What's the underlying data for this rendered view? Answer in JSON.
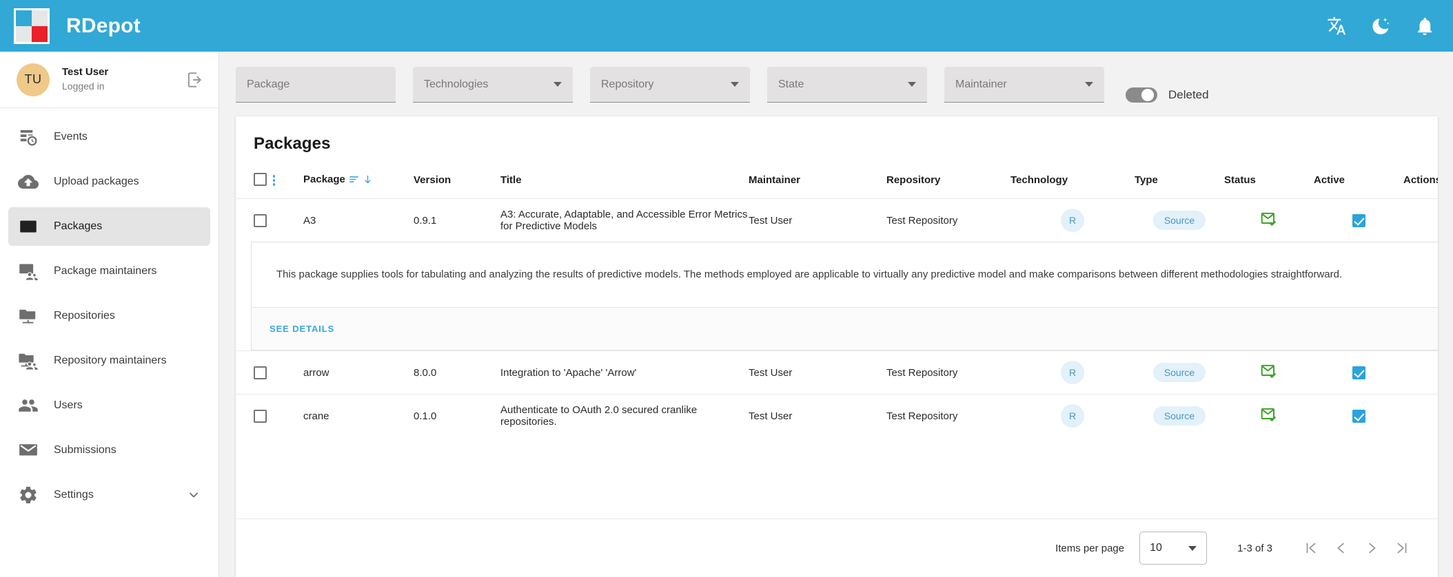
{
  "app": {
    "brand": "RDepot",
    "logo_colors": {
      "blue": "#31a8d5",
      "gray": "#e6e7e8",
      "red": "#e8212a"
    },
    "accent": "#31a8d5"
  },
  "topbar": {
    "icons": [
      {
        "name": "language-icon",
        "label": "Language"
      },
      {
        "name": "dark-mode-icon",
        "label": "Dark mode"
      },
      {
        "name": "notifications-icon",
        "label": "Notifications"
      }
    ]
  },
  "sidebar": {
    "user": {
      "initials": "TU",
      "name": "Test User",
      "status": "Logged in",
      "logout_icon": "logout-icon"
    },
    "items": [
      {
        "label": "Events",
        "icon": "events-icon",
        "active": false,
        "expandable": false
      },
      {
        "label": "Upload packages",
        "icon": "upload-cloud-icon",
        "active": false,
        "expandable": false
      },
      {
        "label": "Packages",
        "icon": "package-icon",
        "active": true,
        "expandable": false
      },
      {
        "label": "Package maintainers",
        "icon": "package-maintainers-icon",
        "active": false,
        "expandable": false
      },
      {
        "label": "Repositories",
        "icon": "repository-icon",
        "active": false,
        "expandable": false
      },
      {
        "label": "Repository maintainers",
        "icon": "repository-maintainers-icon",
        "active": false,
        "expandable": false
      },
      {
        "label": "Users",
        "icon": "users-icon",
        "active": false,
        "expandable": false
      },
      {
        "label": "Submissions",
        "icon": "submissions-icon",
        "active": false,
        "expandable": false
      },
      {
        "label": "Settings",
        "icon": "gear-icon",
        "active": false,
        "expandable": true
      }
    ]
  },
  "filters": {
    "fields": [
      {
        "name": "package-filter",
        "placeholder": "Package",
        "value": "",
        "type": "text"
      },
      {
        "name": "technologies-filter",
        "placeholder": "Technologies",
        "value": "",
        "type": "select"
      },
      {
        "name": "repository-filter",
        "placeholder": "Repository",
        "value": "",
        "type": "select"
      },
      {
        "name": "state-filter",
        "placeholder": "State",
        "value": "",
        "type": "select"
      },
      {
        "name": "maintainer-filter",
        "placeholder": "Maintainer",
        "value": "",
        "type": "select"
      }
    ],
    "deleted_toggle": {
      "label": "Deleted",
      "checked": false
    }
  },
  "table": {
    "title": "Packages",
    "sort": {
      "column": "Package",
      "direction": "desc"
    },
    "header_checkbox_checked": false,
    "columns": [
      "Package",
      "Version",
      "Title",
      "Maintainer",
      "Repository",
      "Technology",
      "Type",
      "Status",
      "Active",
      "Actions"
    ],
    "rows": [
      {
        "selected": false,
        "package": "A3",
        "version": "0.9.1",
        "title": "A3: Accurate, Adaptable, and Accessible Error Metrics for Predictive Models",
        "maintainer": "Test User",
        "repository": "Test Repository",
        "technology": "R",
        "type": "Source",
        "status_icon": "mail-check-icon",
        "active": true,
        "action_icon": "trash-icon",
        "expanded": true,
        "detail": {
          "description": "This package supplies tools for tabulating and analyzing the results of predictive models. The methods employed are applicable to virtually any predictive model and make comparisons between different methodologies straightforward.",
          "see_details_label": "SEE DETAILS"
        }
      },
      {
        "selected": false,
        "package": "arrow",
        "version": "8.0.0",
        "title": "Integration to 'Apache' 'Arrow'",
        "maintainer": "Test User",
        "repository": "Test Repository",
        "technology": "R",
        "type": "Source",
        "status_icon": "mail-check-icon",
        "active": true,
        "action_icon": "trash-icon",
        "expanded": false
      },
      {
        "selected": false,
        "package": "crane",
        "version": "0.1.0",
        "title": "Authenticate to OAuth 2.0 secured cranlike repositories.",
        "maintainer": "Test User",
        "repository": "Test Repository",
        "technology": "R",
        "type": "Source",
        "status_icon": "mail-check-icon",
        "active": true,
        "action_icon": "trash-icon",
        "expanded": false
      }
    ]
  },
  "paginator": {
    "items_per_page_label": "Items per page",
    "items_per_page_value": "10",
    "range_label": "1-3 of 3",
    "buttons": [
      {
        "name": "first-page-button",
        "glyph": "first"
      },
      {
        "name": "previous-page-button",
        "glyph": "prev"
      },
      {
        "name": "next-page-button",
        "glyph": "next"
      },
      {
        "name": "last-page-button",
        "glyph": "last"
      }
    ]
  },
  "colors": {
    "brand_blue": "#31a8d5",
    "link_blue": "#3aa7dd",
    "chip_bg": "#e2f1fa",
    "chip_fg": "#4b96c4",
    "status_green": "#3fa52a",
    "delete_red": "#f01c1c",
    "avatar_bg": "#efc98a"
  }
}
